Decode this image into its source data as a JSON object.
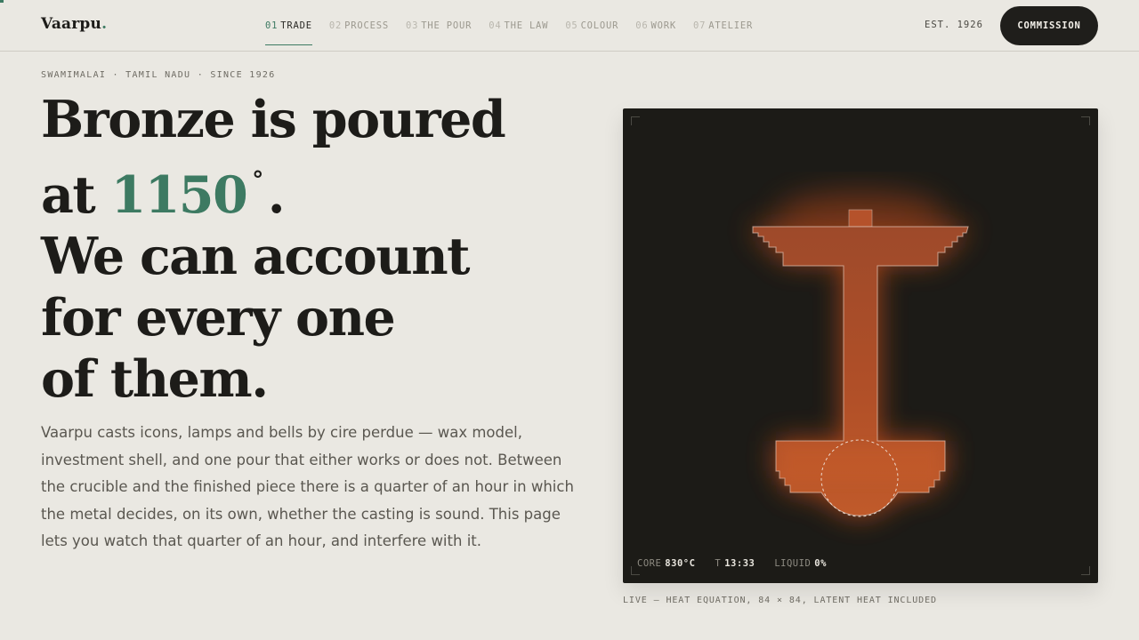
{
  "brand": {
    "name": "Vaarpu",
    "dot": "."
  },
  "nav": [
    {
      "num": "01",
      "label": "TRADE",
      "active": true
    },
    {
      "num": "02",
      "label": "PROCESS"
    },
    {
      "num": "03",
      "label": "THE POUR"
    },
    {
      "num": "04",
      "label": "THE LAW"
    },
    {
      "num": "05",
      "label": "COLOUR"
    },
    {
      "num": "06",
      "label": "WORK"
    },
    {
      "num": "07",
      "label": "ATELIER"
    }
  ],
  "header": {
    "est": "EST. 1926",
    "cta": "COMMISSION"
  },
  "hero": {
    "eyebrow": "SWAMIMALAI · TAMIL NADU · SINCE 1926",
    "line1": "Bronze is poured",
    "line2_pre": "at ",
    "temp": "1150",
    "deg": "°",
    "line2_post": ".",
    "line3": "We can account",
    "line4": "for every one",
    "line5": "of them.",
    "lede": "Vaarpu casts icons, lamps and bells by cire perdue — wax model, investment shell, and one pour that either works or does not. Between the crucible and the finished piece there is a quarter of an hour in which the metal decides, on its own, whether the casting is sound. This page lets you watch that quarter of an hour, and interfere with it."
  },
  "simulation": {
    "readout": [
      {
        "label": "CORE",
        "value": "830°C"
      },
      {
        "label": "T",
        "value": "13:33"
      },
      {
        "label": "LIQUID",
        "value": "0%"
      }
    ],
    "caption": "LIVE — HEAT EQUATION, 84 × 84, LATENT HEAT INCLUDED"
  },
  "colors": {
    "accent": "#3d7a62",
    "background": "#eae8e2",
    "ink": "#1d1c19",
    "panel": "#1c1b17",
    "metal": "#b8562c",
    "glow": "#e4571e"
  }
}
